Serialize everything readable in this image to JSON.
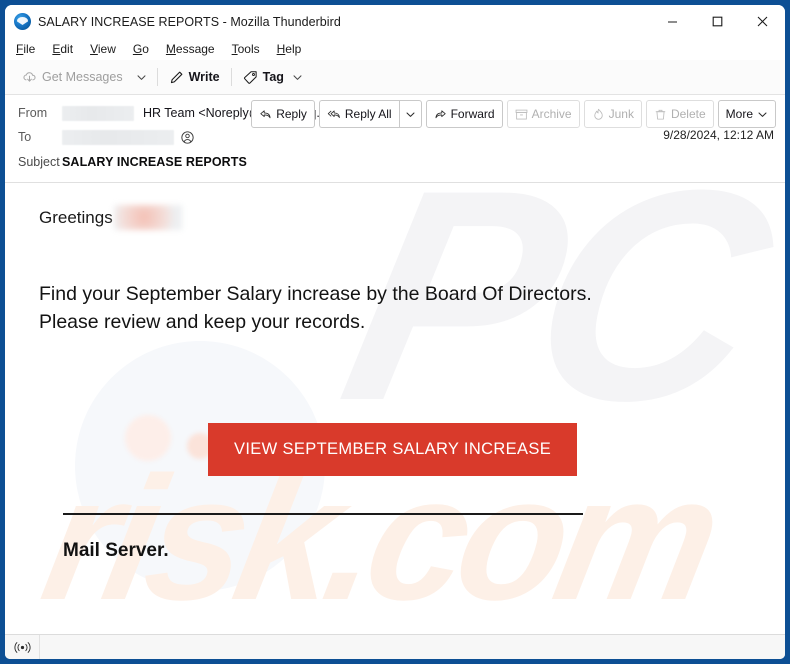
{
  "window": {
    "title": "SALARY INCREASE REPORTS - Mozilla Thunderbird",
    "logo_icon": "thunderbird-logo",
    "minimize_icon": "minimize-icon",
    "maximize_icon": "maximize-icon",
    "close_icon": "close-icon",
    "border_color": "#0d4f94"
  },
  "menubar": {
    "items": [
      {
        "label": "File",
        "accel": "F"
      },
      {
        "label": "Edit",
        "accel": "E"
      },
      {
        "label": "View",
        "accel": "V"
      },
      {
        "label": "Go",
        "accel": "G"
      },
      {
        "label": "Message",
        "accel": "M"
      },
      {
        "label": "Tools",
        "accel": "T"
      },
      {
        "label": "Help",
        "accel": "H"
      }
    ]
  },
  "toolbar": {
    "get_messages_label": "Get Messages",
    "get_messages_icon": "cloud-download-icon",
    "get_messages_enabled": false,
    "get_messages_chevron_icon": "chevron-down-icon",
    "write_label": "Write",
    "write_icon": "pencil-icon",
    "tag_label": "Tag",
    "tag_icon": "tag-icon",
    "tag_chevron_icon": "chevron-down-icon"
  },
  "header": {
    "from_label": "From",
    "from_redacted": true,
    "sender": "HR Team <Noreply@ohsunghq.co.kr>",
    "from_contact_icon": "contact-avatar-icon",
    "to_label": "To",
    "to_redacted": true,
    "to_contact_icon": "contact-avatar-icon",
    "subject_label": "Subject",
    "subject": "SALARY INCREASE REPORTS",
    "date": "9/28/2024, 12:12 AM"
  },
  "actions": [
    {
      "label": "Reply",
      "icon": "reply-icon",
      "enabled": true
    },
    {
      "label": "Reply All",
      "icon": "reply-all-icon",
      "enabled": true
    },
    {
      "label": "",
      "icon": "chevron-down-icon",
      "enabled": true
    },
    {
      "label": "Forward",
      "icon": "forward-icon",
      "enabled": true
    },
    {
      "label": "Archive",
      "icon": "archive-box-icon",
      "enabled": false
    },
    {
      "label": "Junk",
      "icon": "flame-icon",
      "enabled": false
    },
    {
      "label": "Delete",
      "icon": "trash-icon",
      "enabled": false
    },
    {
      "label": "More",
      "icon": "chevron-down-icon",
      "enabled": true
    }
  ],
  "body": {
    "greeting": "Greetings",
    "greeting_name_redacted": true,
    "paragraph_line1": "Find your September Salary increase by the Board Of Directors.",
    "paragraph_line2": "Please review and keep your records.",
    "cta_label": "VIEW SEPTEMBER SALARY INCREASE",
    "cta_color": "#d93a2b",
    "signature": "Mail Server.",
    "watermark_primary": "PC",
    "watermark_secondary": "risk.com"
  },
  "statusbar": {
    "connection_icon": "broadcast-icon",
    "text": ""
  }
}
